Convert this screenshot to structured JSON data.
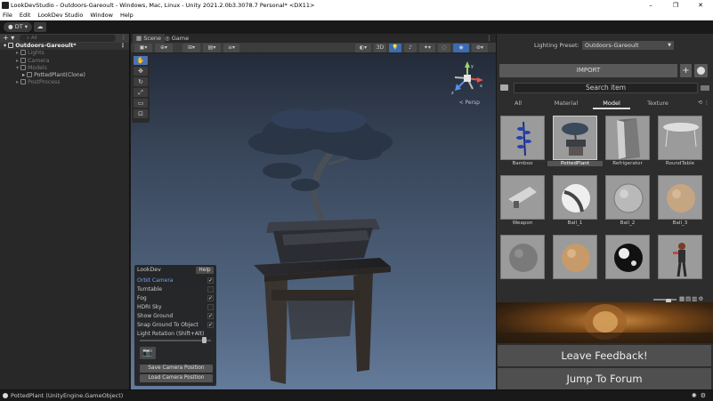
{
  "window": {
    "title": "LookDevStudio - Outdoors-Gareoult - Windows, Mac, Linux - Unity 2021.2.0b3.3078.7 Personal* <DX11>",
    "controls": [
      "–",
      "❐",
      "✕"
    ]
  },
  "menu": [
    "File",
    "Edit",
    "LookDev Studio",
    "Window",
    "Help"
  ],
  "toolbar": {
    "account": "DT ▾"
  },
  "hierarchy": {
    "search_placeholder": "All",
    "scene": "Outdoors-Gareoult*",
    "items": [
      {
        "label": "Lights",
        "depth": 2,
        "dim": true,
        "arrow": "▸"
      },
      {
        "label": "Camera",
        "depth": 2,
        "dim": true,
        "arrow": "▸"
      },
      {
        "label": "Models",
        "depth": 2,
        "dim": true,
        "arrow": "▾"
      },
      {
        "label": "PottedPlant(Clone)",
        "depth": 3,
        "dim": false,
        "arrow": "▸"
      },
      {
        "label": "PostProcess",
        "depth": 2,
        "dim": true,
        "arrow": "▸"
      }
    ]
  },
  "scene_tabs": {
    "scene": "Scene",
    "game": "Game"
  },
  "scene_toolbar": {
    "mode_2d3d": "3D"
  },
  "gizmo": {
    "persp_label": "< Persp",
    "y": "y",
    "x": "x",
    "z": "z"
  },
  "lookdev": {
    "title": "LookDev",
    "help": "Help",
    "options": [
      {
        "label": "Orbit Camera",
        "checked": true,
        "selected": true
      },
      {
        "label": "Turntable",
        "checked": false
      },
      {
        "label": "Fog",
        "checked": true
      },
      {
        "label": "HDRI Sky",
        "checked": false
      },
      {
        "label": "Show Ground",
        "checked": true
      },
      {
        "label": "Snap Ground To Object",
        "checked": true
      }
    ],
    "light_rotation_label": "Light Rotation (Shift+Alt)",
    "light_rotation_value": 0.9,
    "save_camera": "Save Camera Position",
    "load_camera": "Load Camera Position"
  },
  "panel": {
    "lighting_label": "Lighting Preset:",
    "lighting_value": "Outdoors-Gareoult",
    "import_label": "IMPORT",
    "search_placeholder": "Search item",
    "tabs": [
      "All",
      "Material",
      "Model",
      "Texture"
    ],
    "active_tab": "Model",
    "items": [
      {
        "name": "Bamboo",
        "selected": false
      },
      {
        "name": "PottedPlant",
        "selected": true
      },
      {
        "name": "Refrigerator",
        "selected": false
      },
      {
        "name": "RoundTable",
        "selected": false
      },
      {
        "name": "Weapon",
        "selected": false
      },
      {
        "name": "Ball_1",
        "selected": false
      },
      {
        "name": "Ball_2",
        "selected": false
      },
      {
        "name": "Ball_3",
        "selected": false
      },
      {
        "name": "",
        "selected": false
      },
      {
        "name": "",
        "selected": false
      },
      {
        "name": "",
        "selected": false
      },
      {
        "name": "",
        "selected": false
      }
    ],
    "zoom_level": 0.65,
    "leave_feedback": "Leave Feedback!",
    "jump_forum": "Jump To Forum"
  },
  "status": {
    "text": "PottedPlant (UnityEngine.GameObject)"
  }
}
